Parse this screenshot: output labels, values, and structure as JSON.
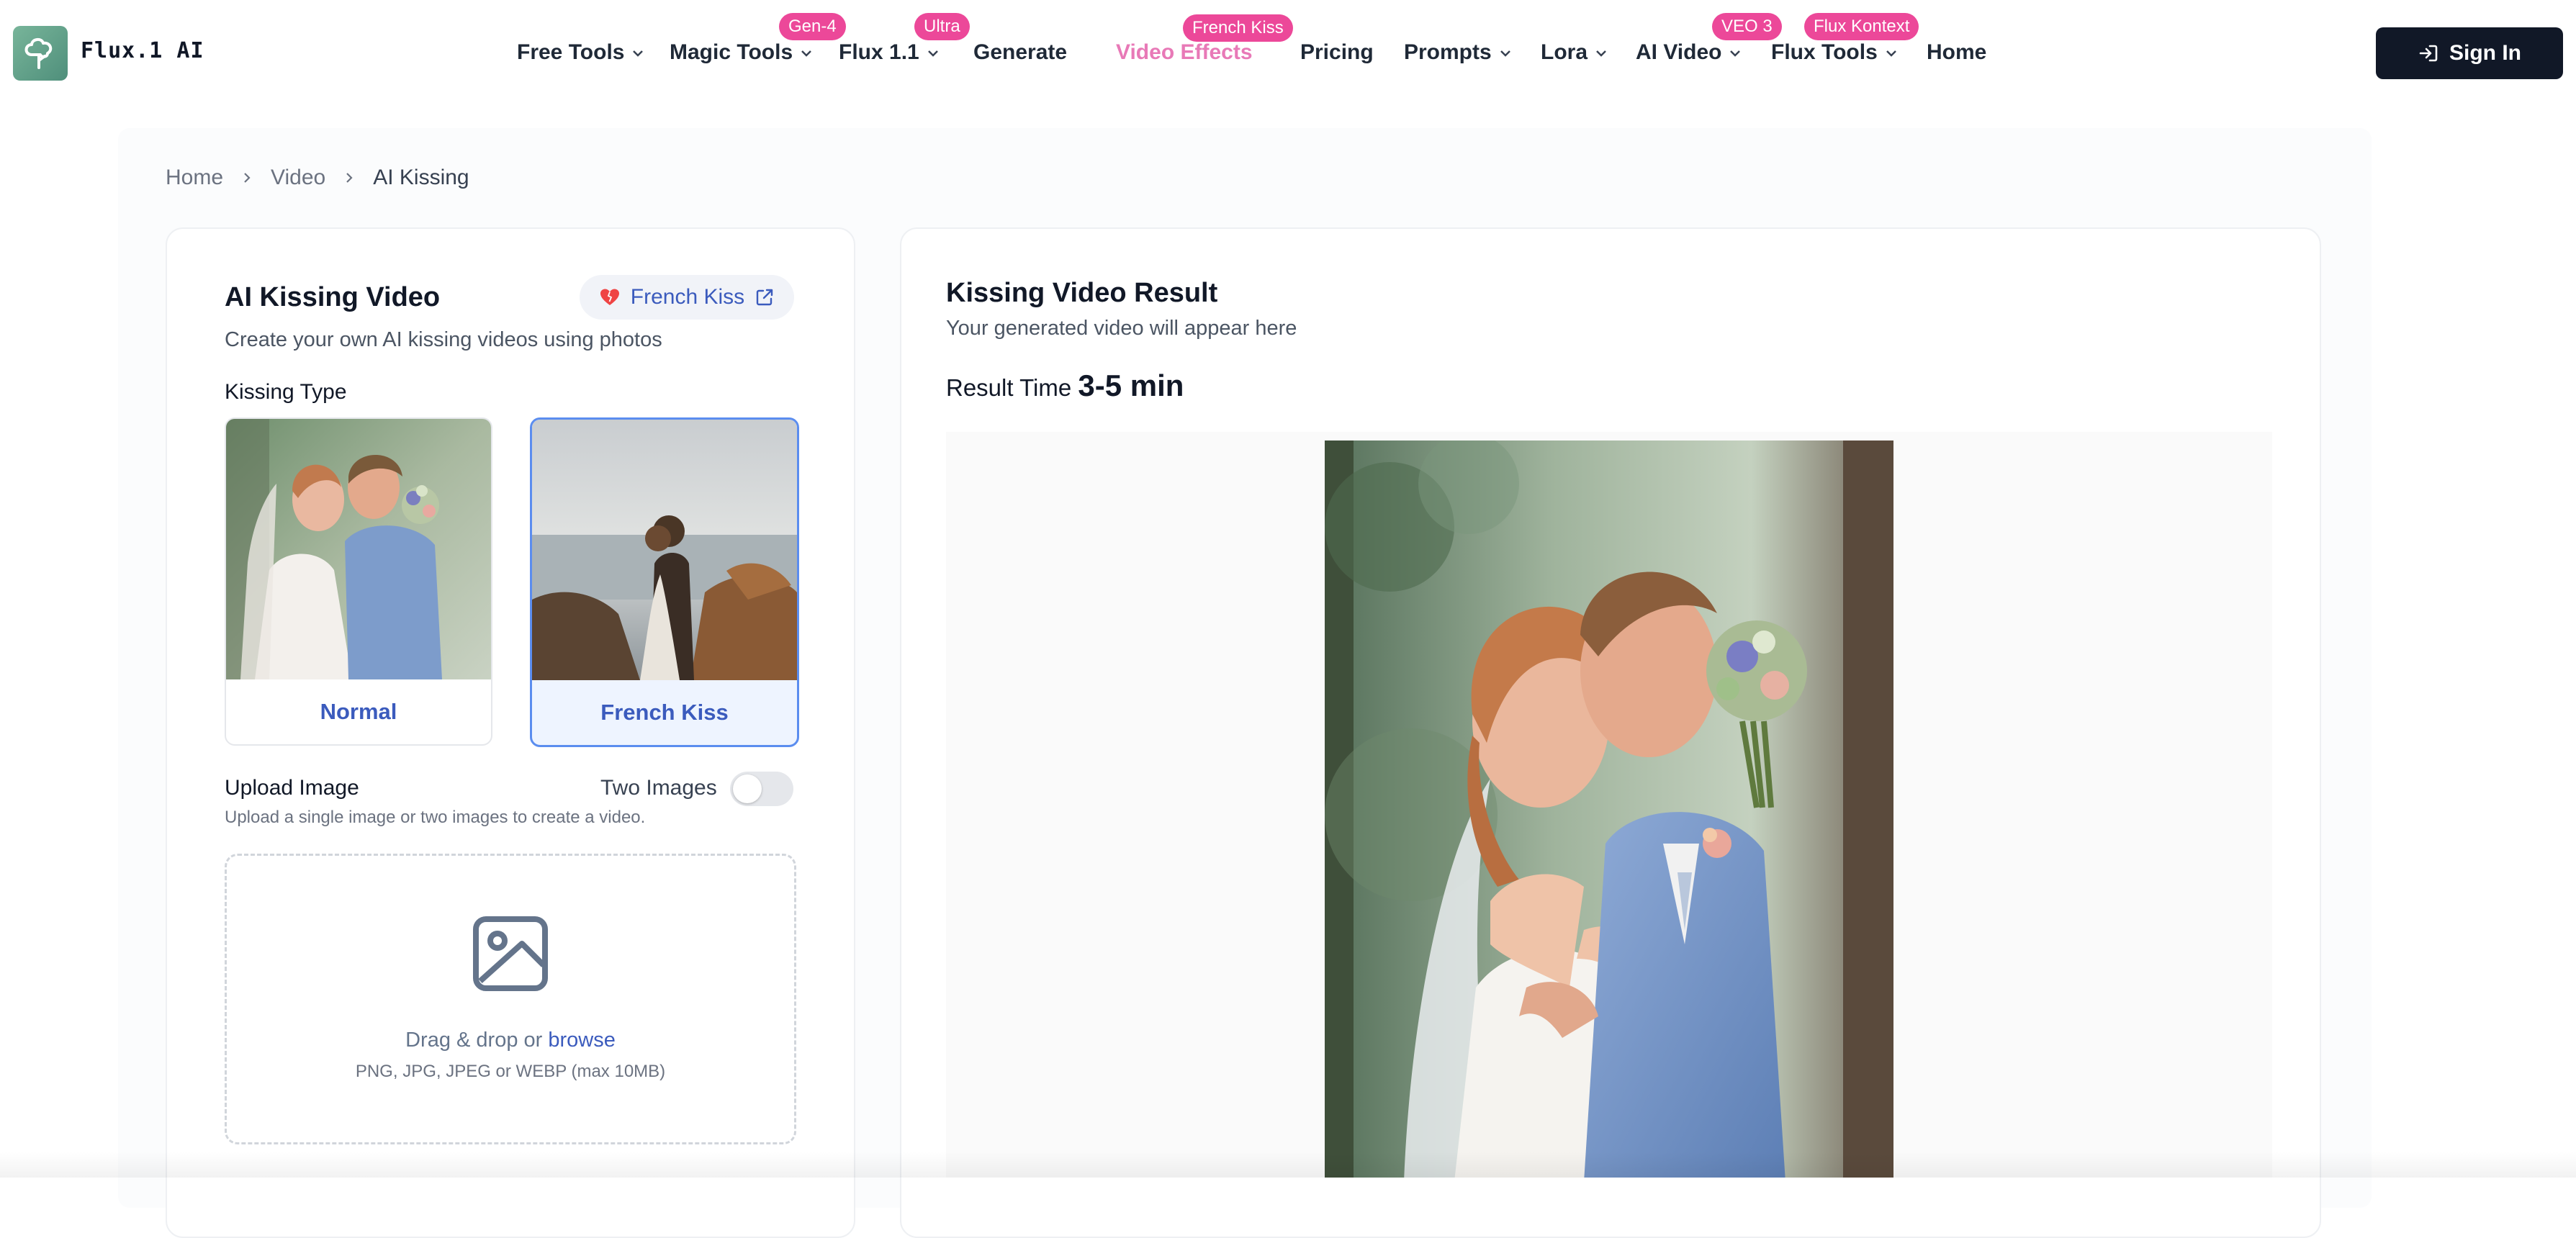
{
  "app": {
    "logo_text": "Flux.1 AI"
  },
  "nav": {
    "items": [
      {
        "label": "Free Tools",
        "dropdown": true
      },
      {
        "label": "Magic Tools",
        "dropdown": true,
        "badge": "Gen-4"
      },
      {
        "label": "Flux 1.1",
        "dropdown": true,
        "badge": "Ultra"
      },
      {
        "label": "Generate",
        "dropdown": false
      },
      {
        "label": "Video Effects",
        "dropdown": false,
        "badge": "French Kiss",
        "active": true
      },
      {
        "label": "Pricing",
        "dropdown": false
      },
      {
        "label": "Prompts",
        "dropdown": true
      },
      {
        "label": "Lora",
        "dropdown": true
      },
      {
        "label": "AI Video",
        "dropdown": true,
        "badge": "VEO 3"
      },
      {
        "label": "Flux Tools",
        "dropdown": true,
        "badge": "Flux Kontext"
      },
      {
        "label": "Home",
        "dropdown": false
      }
    ],
    "signin_label": "Sign In"
  },
  "breadcrumb": {
    "items": [
      "Home",
      "Video",
      "AI Kissing"
    ]
  },
  "left_panel": {
    "title": "AI Kissing Video",
    "pill_label": "French Kiss",
    "subtitle": "Create your own AI kissing videos using photos",
    "kissing_type_label": "Kissing Type",
    "types": [
      {
        "label": "Normal",
        "selected": false
      },
      {
        "label": "French Kiss",
        "selected": true
      }
    ],
    "upload_label": "Upload Image",
    "two_images_label": "Two Images",
    "two_images_enabled": false,
    "upload_help": "Upload a single image or two images to create a video.",
    "dropzone": {
      "text_prefix": "Drag & drop or",
      "browse_label": "browse",
      "formats": "PNG, JPG, JPEG or WEBP (max 10MB)"
    }
  },
  "right_panel": {
    "title": "Kissing Video Result",
    "subtitle": "Your generated video will appear here",
    "result_time_label": "Result Time",
    "result_time_value": "3-5 min"
  },
  "colors": {
    "accent_blue": "#3b5bbd",
    "badge_pink": "#ec4899",
    "active_nav": "#e879b7",
    "signin_bg": "#111827"
  }
}
